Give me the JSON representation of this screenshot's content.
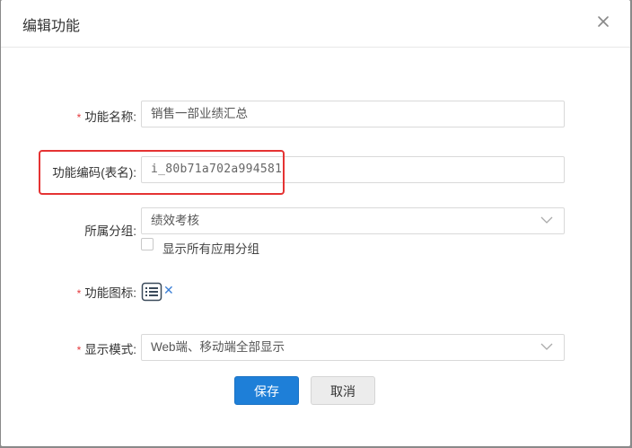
{
  "dialog": {
    "title": "编辑功能"
  },
  "form": {
    "function_name": {
      "label": "功能名称:",
      "required": true,
      "value": "销售一部业绩汇总"
    },
    "function_code": {
      "label": "功能编码(表名):",
      "required": false,
      "value": "i_80b71a702a994581"
    },
    "group": {
      "label": "所属分组:",
      "required": false,
      "value": "绩效考核"
    },
    "show_all_groups": {
      "label": "显示所有应用分组",
      "checked": false
    },
    "function_icon": {
      "label": "功能图标:",
      "required": true,
      "icon": "list-icon"
    },
    "display_mode": {
      "label": "显示模式:",
      "required": true,
      "value": "Web端、移动端全部显示"
    }
  },
  "buttons": {
    "save": "保存",
    "cancel": "取消"
  },
  "colors": {
    "primary": "#1e7fd8",
    "required": "#e4393c",
    "highlight": "#e53333"
  }
}
